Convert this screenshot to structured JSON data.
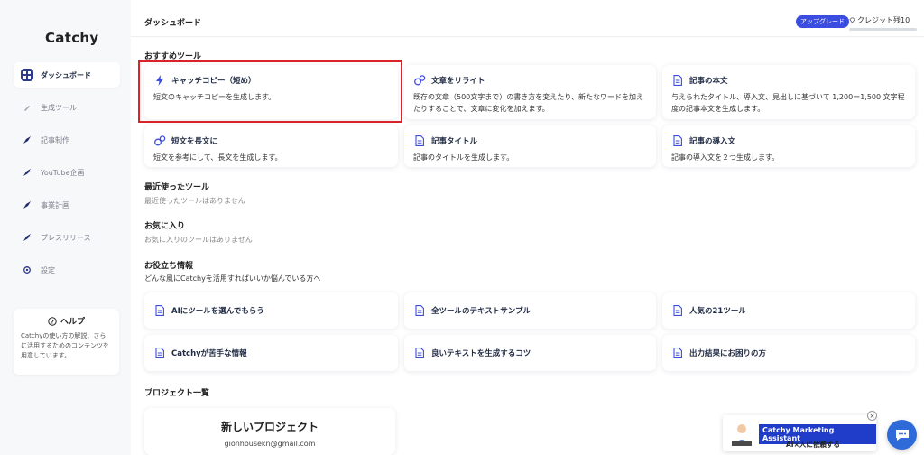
{
  "app": {
    "logo": "Catchy"
  },
  "sidebar": {
    "items": [
      {
        "label": "ダッシュボード",
        "icon": "grid-icon",
        "active": true
      },
      {
        "label": "生成ツール",
        "icon": "pen-icon"
      },
      {
        "label": "記事制作",
        "icon": "rocket-icon"
      },
      {
        "label": "YouTube企画",
        "icon": "rocket-icon"
      },
      {
        "label": "事業計画",
        "icon": "rocket-icon"
      },
      {
        "label": "プレスリリース",
        "icon": "rocket-icon"
      },
      {
        "label": "設定",
        "icon": "gear-icon"
      }
    ],
    "help": {
      "title": "ヘルプ",
      "text": "Catchyの使い方の解説、さらに活用するためのコンテンツを用意しています。"
    }
  },
  "header": {
    "title": "ダッシュボード",
    "upgrade_label": "アップグレード",
    "credit_label": "クレジット残10"
  },
  "recommended": {
    "title": "おすすめツール",
    "cards": [
      {
        "title": "キャッチコピー（短め）",
        "desc": "短文のキャッチコピーを生成します。",
        "icon": "lightning-icon"
      },
      {
        "title": "文章をリライト",
        "desc": "既存の文章（500文字まで）の書き方を変えたり、新たなワードを加えたりすることで、文章に変化を加えます。",
        "icon": "bubbles-icon"
      },
      {
        "title": "記事の本文",
        "desc": "与えられたタイトル、導入文、見出しに基づいて 1,200ー1,500 文字程度の記事本文を生成します。",
        "icon": "document-icon"
      },
      {
        "title": "短文を長文に",
        "desc": "短文を参考にして、長文を生成します。",
        "icon": "bubbles-icon"
      },
      {
        "title": "記事タイトル",
        "desc": "記事のタイトルを生成します。",
        "icon": "document-icon"
      },
      {
        "title": "記事の導入文",
        "desc": "記事の導入文を２つ生成します。",
        "icon": "document-icon"
      }
    ]
  },
  "recent": {
    "title": "最近使ったツール",
    "empty": "最近使ったツールはありません"
  },
  "favorites": {
    "title": "お気に入り",
    "empty": "お気に入りのツールはありません"
  },
  "tips": {
    "title": "お役立ち情報",
    "subtitle": "どんな風にCatchyを活用すればいいか悩んでいる方へ",
    "links": [
      "AIにツールを選んでもらう",
      "全ツールのテキストサンプル",
      "人気の21ツール",
      "Catchyが苦手な情報",
      "良いテキストを生成するコツ",
      "出力結果にお困りの方"
    ]
  },
  "projects": {
    "title": "プロジェクト一覧",
    "new_title": "新しいプロジェクト",
    "email": "gionhousekn@gmail.com"
  },
  "assistant": {
    "title": "Catchy Marketing Assistant",
    "subtitle": "AI×人に依頼する"
  },
  "colors": {
    "accent": "#3b4de0",
    "selection": "#d9232a",
    "chat": "#2f6ad9"
  }
}
